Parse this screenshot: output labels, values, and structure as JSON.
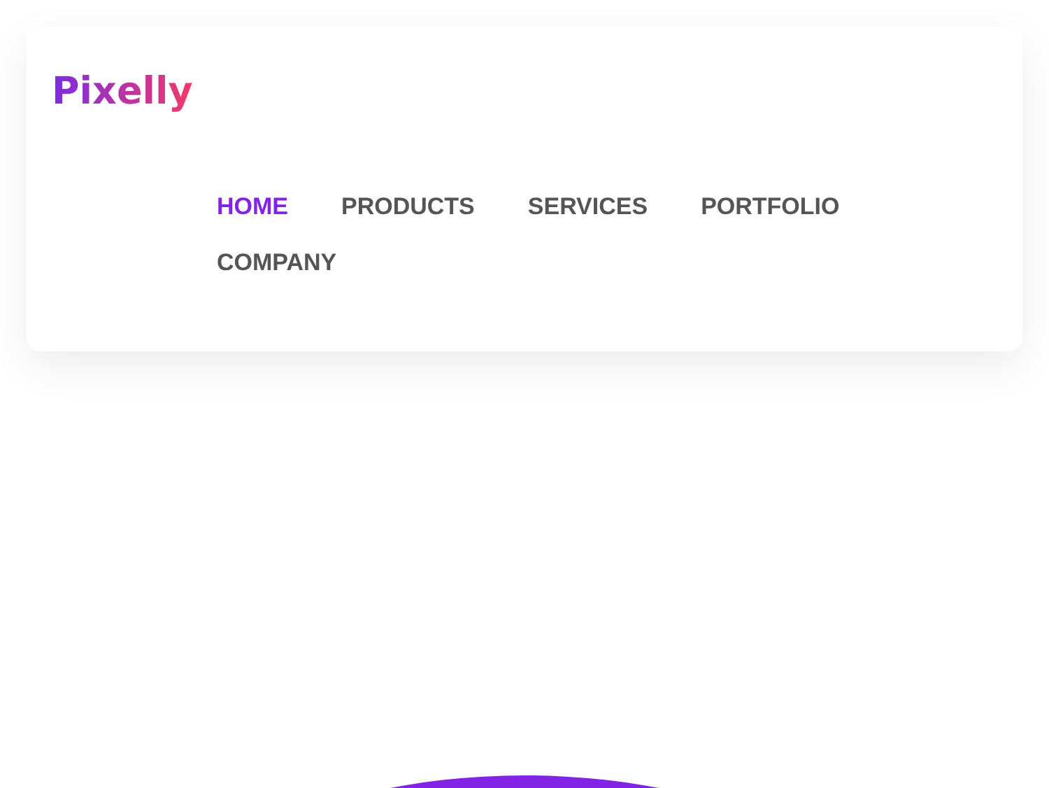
{
  "logo": "Pixelly",
  "nav": [
    {
      "label": "HOME",
      "selected": true
    },
    {
      "label": "PRODUCTS",
      "selected": false
    },
    {
      "label": "SERVICES",
      "selected": false
    },
    {
      "label": "PORTFOLIO",
      "selected": false
    },
    {
      "label": "COMPANY",
      "selected": false
    }
  ]
}
